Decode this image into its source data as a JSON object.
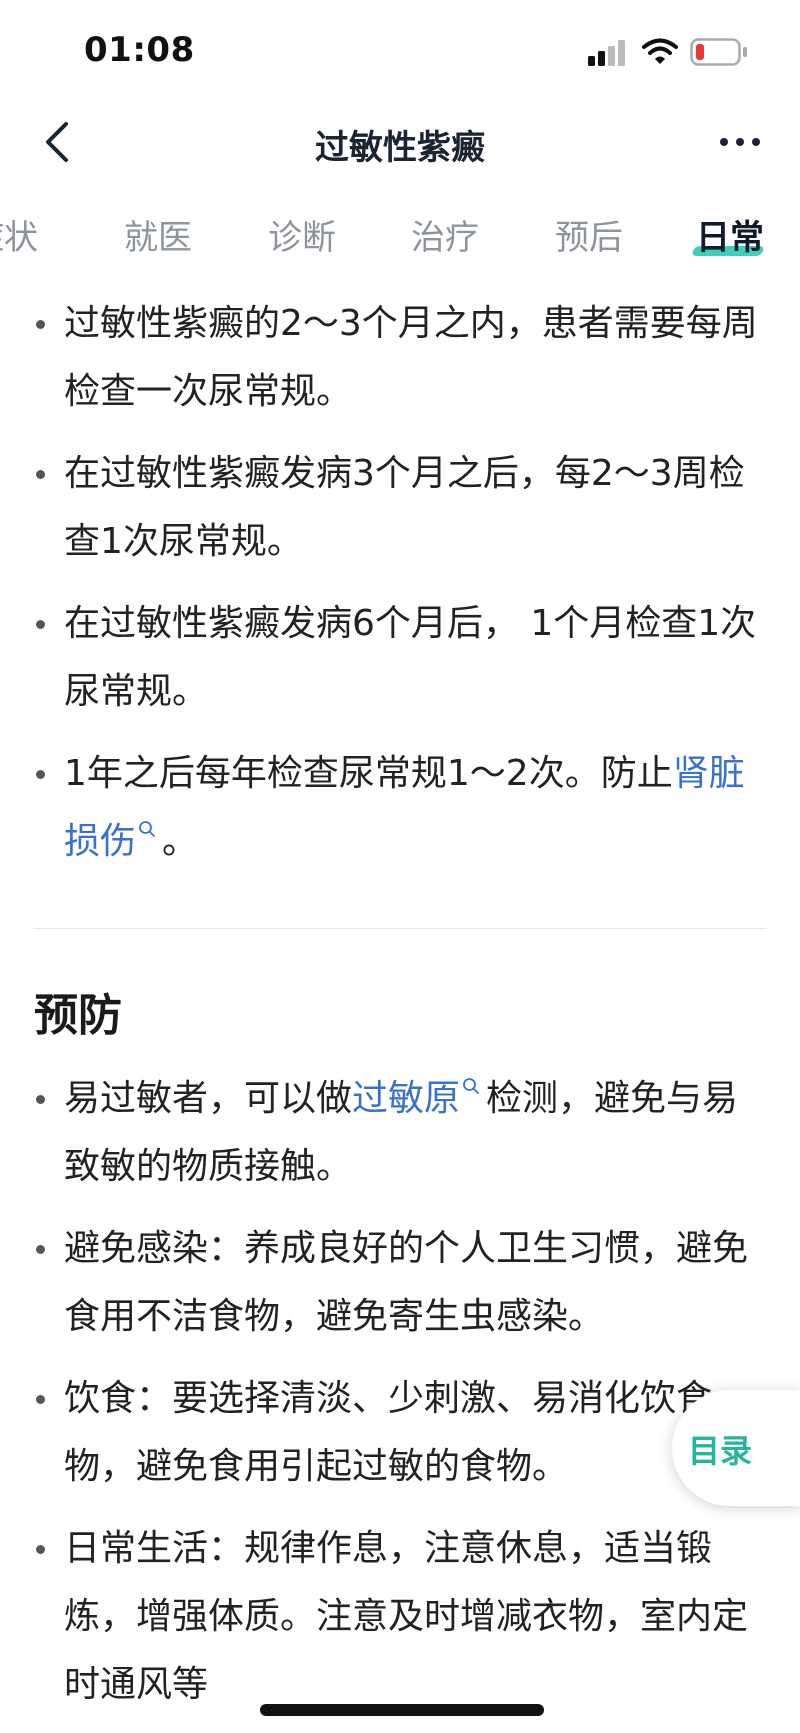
{
  "status_bar": {
    "time": "01:08"
  },
  "nav": {
    "title": "过敏性紫癜"
  },
  "tabs": [
    {
      "label": "症状"
    },
    {
      "label": "就医"
    },
    {
      "label": "诊断"
    },
    {
      "label": "治疗"
    },
    {
      "label": "预后"
    },
    {
      "label": "日常",
      "active": true
    }
  ],
  "checkup_list": [
    {
      "text": "过敏性紫癜的2～3个月之内，患者需要每周检查一次尿常规。"
    },
    {
      "text": "在过敏性紫癜发病3个月之后，每2～3周检查1次尿常规。"
    },
    {
      "text": "在过敏性紫癜发病6个月后， 1个月检查1次尿常规。"
    },
    {
      "before": "1年之后每年检查尿常规1～2次。防止",
      "link": "肾脏损伤",
      "after": "。"
    }
  ],
  "prevention": {
    "title": "预防",
    "items": [
      {
        "before": "易过敏者，可以做",
        "link": "过敏原",
        "after": "检测，避免与易致敏的物质接触。"
      },
      {
        "text": "避免感染：养成良好的个人卫生习惯，避免食用不洁食物，避免寄生虫感染。"
      },
      {
        "text": "饮食：要选择清淡、少刺激、易消化饮食物，避免食用引起过敏的食物。"
      },
      {
        "text": "日常生活：规律作息，注意休息，适当锻炼，增强体质。注意及时增减衣物，室内定时通风等"
      }
    ]
  },
  "toc": {
    "label": "目录"
  },
  "colors": {
    "link": "#3a72c9",
    "accent": "#2cc9b0",
    "toc_text": "#29b39a",
    "battery_low": "#e53935"
  },
  "icons": [
    "back-icon",
    "more-icon",
    "signal-icon",
    "wifi-icon",
    "battery-icon",
    "search-icon"
  ]
}
